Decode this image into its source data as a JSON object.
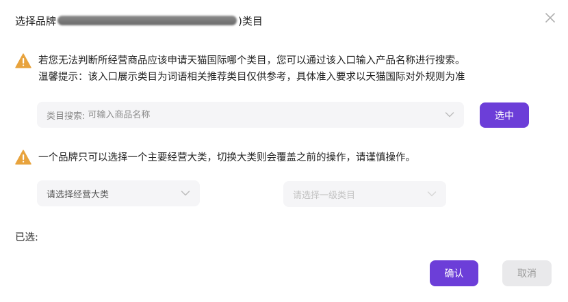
{
  "dialog": {
    "title_prefix": "选择品牌",
    "title_suffix": ")类目",
    "close_label": "×"
  },
  "notice": {
    "line1": "若您无法判断所经营商品应该申请天猫国际哪个类目，您可以通过该入口输入产品名称进行搜索。",
    "line2": "温馨提示：该入口展示类目为词语相关推荐类目仅供参考，具体准入要求以天猫国际对外规则为准"
  },
  "search": {
    "label": "类目搜索:",
    "placeholder": "可输入商品名称",
    "select_button": "选中"
  },
  "warning": {
    "text": "一个品牌只可以选择一个主要经营大类，切换大类则会覆盖之前的操作，请谨慎操作。"
  },
  "category": {
    "main_placeholder": "请选择经营大类",
    "level1_placeholder": "请选择一级类目"
  },
  "selected": {
    "label": "已选:"
  },
  "footer": {
    "confirm": "确认",
    "cancel": "取消"
  },
  "colors": {
    "accent": "#6c3ed8",
    "warning": "#e8a33d",
    "input_bg": "#f5f5f7",
    "disabled_bg": "#e9e9eb"
  },
  "icons": {
    "warning": "warning-triangle-icon",
    "close": "close-icon",
    "dropdown": "chevron-down-icon"
  }
}
